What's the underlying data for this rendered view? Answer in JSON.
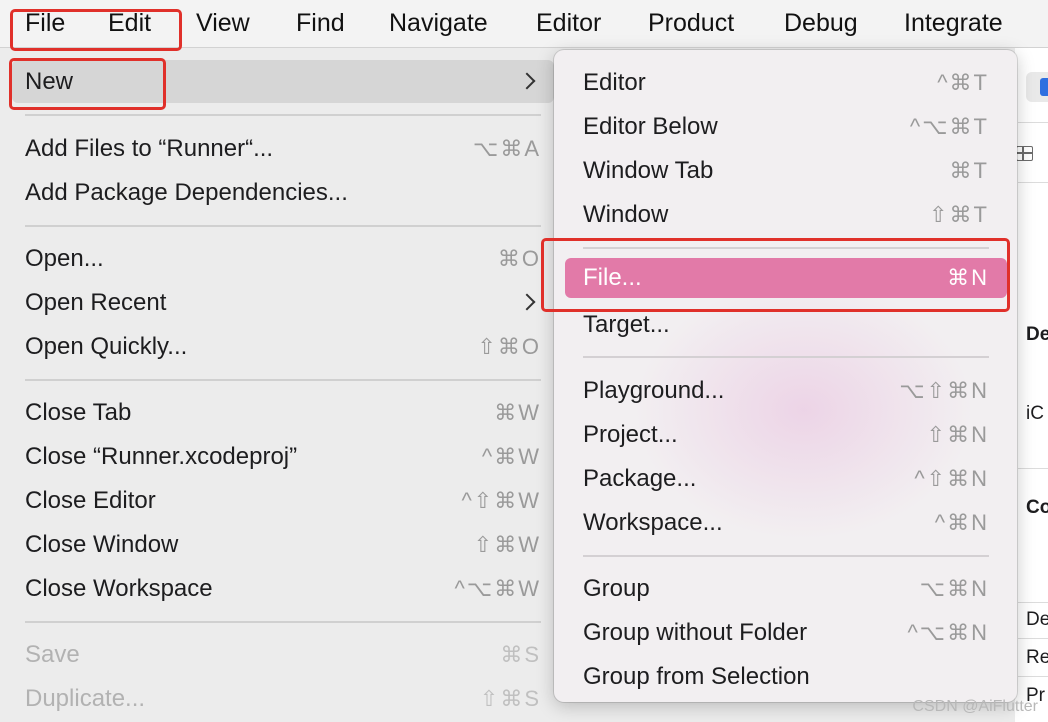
{
  "menubar": {
    "items": [
      "File",
      "Edit",
      "View",
      "Find",
      "Navigate",
      "Editor",
      "Product",
      "Debug",
      "Integrate"
    ]
  },
  "file_menu": {
    "new": {
      "label": "New"
    },
    "add_files": {
      "label": "Add Files to “Runner“...",
      "shortcut": "⌥⌘A"
    },
    "add_packages": {
      "label": "Add Package Dependencies..."
    },
    "open": {
      "label": "Open...",
      "shortcut": "⌘O"
    },
    "open_recent": {
      "label": "Open Recent"
    },
    "open_quickly": {
      "label": "Open Quickly...",
      "shortcut": "⇧⌘O"
    },
    "close_tab": {
      "label": "Close Tab",
      "shortcut": "⌘W"
    },
    "close_project": {
      "label": "Close “Runner.xcodeproj”",
      "shortcut": "^⌘W"
    },
    "close_editor": {
      "label": "Close Editor",
      "shortcut": "^⇧⌘W"
    },
    "close_window": {
      "label": "Close Window",
      "shortcut": "⇧⌘W"
    },
    "close_workspace": {
      "label": "Close Workspace",
      "shortcut": "^⌥⌘W"
    },
    "save": {
      "label": "Save",
      "shortcut": "⌘S"
    },
    "duplicate": {
      "label": "Duplicate...",
      "shortcut": "⇧⌘S"
    }
  },
  "new_submenu": {
    "editor": {
      "label": "Editor",
      "shortcut": "^⌘T"
    },
    "editor_below": {
      "label": "Editor Below",
      "shortcut": "^⌥⌘T"
    },
    "window_tab": {
      "label": "Window Tab",
      "shortcut": "⌘T"
    },
    "window": {
      "label": "Window",
      "shortcut": "⇧⌘T"
    },
    "file": {
      "label": "File...",
      "shortcut": "⌘N"
    },
    "target": {
      "label": "Target..."
    },
    "playground": {
      "label": "Playground...",
      "shortcut": "⌥⇧⌘N"
    },
    "project": {
      "label": "Project...",
      "shortcut": "⇧⌘N"
    },
    "package": {
      "label": "Package...",
      "shortcut": "^⇧⌘N"
    },
    "workspace": {
      "label": "Workspace...",
      "shortcut": "^⌘N"
    },
    "group": {
      "label": "Group",
      "shortcut": "⌥⌘N"
    },
    "group_without_folder": {
      "label": "Group without Folder",
      "shortcut": "^⌥⌘N"
    },
    "group_from_selection": {
      "label": "Group from Selection"
    }
  },
  "background": {
    "text_de1": "De",
    "text_ic": "iC",
    "text_co": "Co",
    "text_de2": "De",
    "text_re": "Re",
    "text_pr": "Pr"
  },
  "watermark": "CSDN @AiFlutter",
  "colors": {
    "selection": "#e27aa8",
    "annotation": "#e0302a",
    "hover": "#d6d6d6"
  }
}
